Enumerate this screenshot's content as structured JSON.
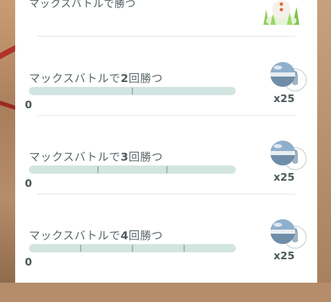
{
  "top_task": {
    "title": "マックスバトルで勝つ"
  },
  "tasks": [
    {
      "title_prefix": "マックスバトルで",
      "title_num": "2",
      "title_suffix": "回勝つ",
      "progress": 0,
      "progress_label": "0",
      "segments": 2,
      "reward": {
        "icon": "max-particle-icon",
        "count_label": "x25"
      }
    },
    {
      "title_prefix": "マックスバトルで",
      "title_num": "3",
      "title_suffix": "回勝つ",
      "progress": 0,
      "progress_label": "0",
      "segments": 3,
      "reward": {
        "icon": "max-particle-icon",
        "count_label": "x25"
      }
    },
    {
      "title_prefix": "マックスバトルで",
      "title_num": "4",
      "title_suffix": "回勝つ",
      "progress": 0,
      "progress_label": "0",
      "segments": 4,
      "reward": {
        "icon": "max-particle-icon",
        "count_label": "x25"
      }
    }
  ],
  "colors": {
    "card_bg": "#ffffff",
    "bar_track": "#d3e5e0",
    "bar_fill": "#76c8a5",
    "text": "#505e5f"
  }
}
